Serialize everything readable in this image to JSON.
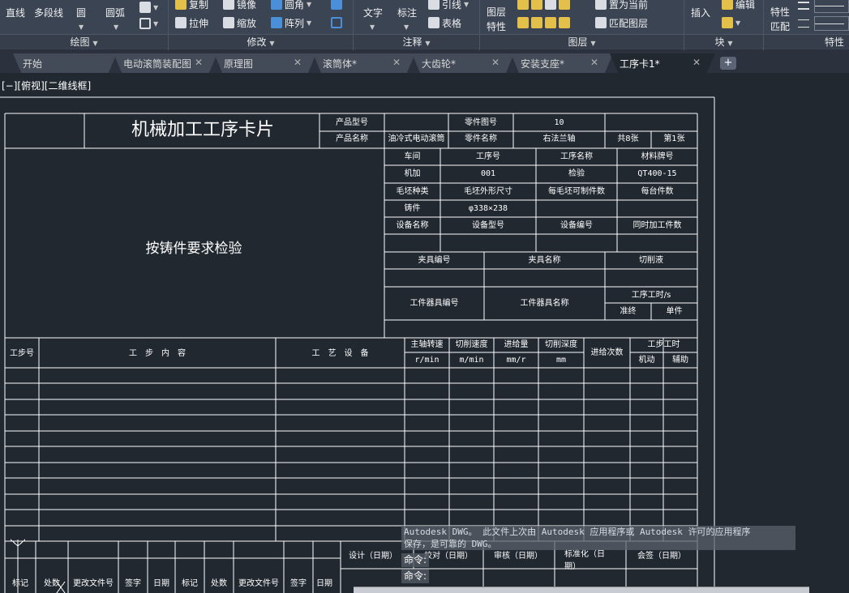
{
  "ribbon": {
    "draw": {
      "title": "绘图",
      "line": "直线",
      "polyline": "多段线",
      "circle": "圆",
      "arc": "圆弧"
    },
    "modify": {
      "title": "修改",
      "copy": "复制",
      "mirror": "镜像",
      "fillet": "圆角",
      "stretch": "拉伸",
      "scale": "缩放",
      "array": "阵列"
    },
    "annotation": {
      "title": "注释",
      "text": "文字",
      "dimension": "标注",
      "leader": "引线",
      "table": "表格"
    },
    "layers": {
      "title": "图层",
      "layer_properties": [
        "图层",
        "特性"
      ],
      "set_current": "置为当前",
      "match_layer": "匹配图层"
    },
    "block": {
      "title": "块",
      "insert": "插入",
      "edit": "编辑"
    },
    "properties": {
      "title": "特性",
      "match": [
        "特性",
        "匹配"
      ]
    }
  },
  "tabs": [
    {
      "label": "开始",
      "active": false
    },
    {
      "label": "电动滚筒装配图",
      "active": false
    },
    {
      "label": "原理图",
      "active": false
    },
    {
      "label": "滚筒体*",
      "active": false
    },
    {
      "label": "大齿轮*",
      "active": false
    },
    {
      "label": "安装支座*",
      "active": false
    },
    {
      "label": "工序卡1*",
      "active": true
    }
  ],
  "viewport_label": "[−][俯视][二维线框]",
  "card": {
    "title": "机械加工工序卡片",
    "product_model_label": "产品型号",
    "part_drawing_no_label": "零件图号",
    "part_drawing_no": "10",
    "product_name_label": "产品名称",
    "product_name": "油冷式电动滚筒",
    "part_name_label": "零件名称",
    "part_name": "右法兰轴",
    "total_sheets": "共8张",
    "sheet_no": "第1张",
    "sketch_note": "按铸件要求检验",
    "info_rows": [
      [
        "车间",
        "工序号",
        "工序名称",
        "材料牌号"
      ],
      [
        "机加",
        "001",
        "检验",
        "QT400-15"
      ],
      [
        "毛坯种类",
        "毛坯外形尺寸",
        "每毛坯可制件数",
        "每台件数"
      ],
      [
        "铸件",
        "φ338×238",
        "",
        ""
      ],
      [
        "设备名称",
        "设备型号",
        "设备编号",
        "同时加工件数"
      ]
    ],
    "fixture_headers": [
      "夹具编号",
      "夹具名称",
      "切削液"
    ],
    "station_tool_headers": [
      "工件器具编号",
      "工件器具名称"
    ],
    "process_time_label": "工序工时/s",
    "prep_final_label": "准终",
    "unit_label": "单件",
    "step_headers": {
      "step_no": "工步号",
      "step_content": "工　步　内　容",
      "equipment": "工　艺　设　备",
      "spindle_speed": "主轴转速",
      "spindle_unit": "r/min",
      "cutting_speed": "切削速度",
      "cutting_unit": "m/min",
      "feed": "进给量",
      "feed_unit": "mm/r",
      "cut_depth": "切削深度",
      "depth_unit": "mm",
      "passes": "进给次数",
      "step_time": "工步工时",
      "machine": "机动",
      "auxiliary": "辅助"
    },
    "signoff": {
      "design": "设计（日期）",
      "check": "校对（日期）",
      "review": "审核（日期）",
      "standard": "标准化（日",
      "standard2": "期）",
      "countersign": "会签（日期）"
    },
    "revision_headers": [
      "标记",
      "处数",
      "更改文件号",
      "签字",
      "日期",
      "标记",
      "处数",
      "更改文件号",
      "签字",
      "日期"
    ]
  },
  "command": {
    "message_line1": "Autodesk DWG。  此文件上次由 Autodesk 应用程序或 Autodesk 许可的应用程序",
    "message_line2": "保存，是可靠的 DWG。",
    "prompt": "命令:"
  },
  "colors": {
    "background": "#212830",
    "ribbon": "#3b4453",
    "lines": "#ffffff",
    "tab_active": "#212830"
  }
}
